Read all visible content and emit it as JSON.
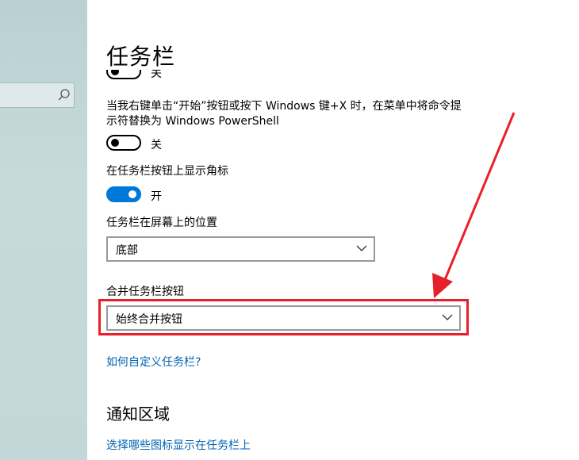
{
  "page": {
    "title": "任务栏"
  },
  "settings": {
    "partial_toggle": {
      "state": "关"
    },
    "powershell": {
      "label_line1": "当我右键单击“开始”按钮或按下 Windows 键+X 时，在菜单中将命令提",
      "label_line2": "示符替换为 Windows PowerShell",
      "state": "关"
    },
    "badges": {
      "label": "在任务栏按钮上显示角标",
      "state": "开"
    },
    "position": {
      "label": "任务栏在屏幕上的位置",
      "value": "底部"
    },
    "combine": {
      "label": "合并任务栏按钮",
      "value": "始终合并按钮"
    },
    "help_link": "如何自定义任务栏?"
  },
  "notification_area": {
    "title": "通知区域",
    "link": "选择哪些图标显示在任务栏上"
  },
  "colors": {
    "accent": "#0078d7",
    "link": "#0063b1",
    "annotation": "#e8202a"
  }
}
